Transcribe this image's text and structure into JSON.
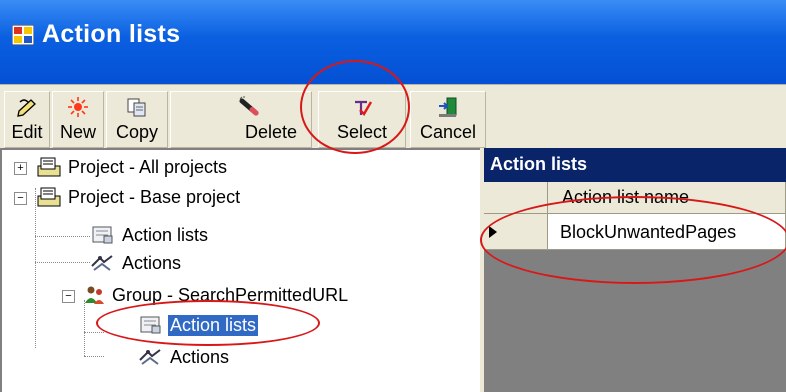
{
  "window": {
    "title": "Action lists"
  },
  "toolbar": {
    "edit_label": "Edit",
    "new_label": "New",
    "copy_label": "Copy",
    "delete_label": "Delete",
    "select_label": "Select",
    "cancel_label": "Cancel"
  },
  "tree": {
    "items": [
      {
        "label": "Project - All projects",
        "expander": "+"
      },
      {
        "label": "Project - Base project",
        "expander": "−"
      },
      {
        "label": "Action lists"
      },
      {
        "label": "Actions"
      },
      {
        "label": "Group - SearchPermittedURL",
        "expander": "−"
      },
      {
        "label": "Action lists",
        "selected": true
      },
      {
        "label": "Actions"
      }
    ]
  },
  "grid": {
    "caption": "Action lists",
    "columns": [
      "Action list name"
    ],
    "rows": [
      [
        "BlockUnwantedPages"
      ]
    ]
  },
  "colors": {
    "titlebar": "#0a5fe0",
    "selection": "#316ac5",
    "grid_caption": "#0a246a",
    "annotation_circle": "#d81818"
  }
}
